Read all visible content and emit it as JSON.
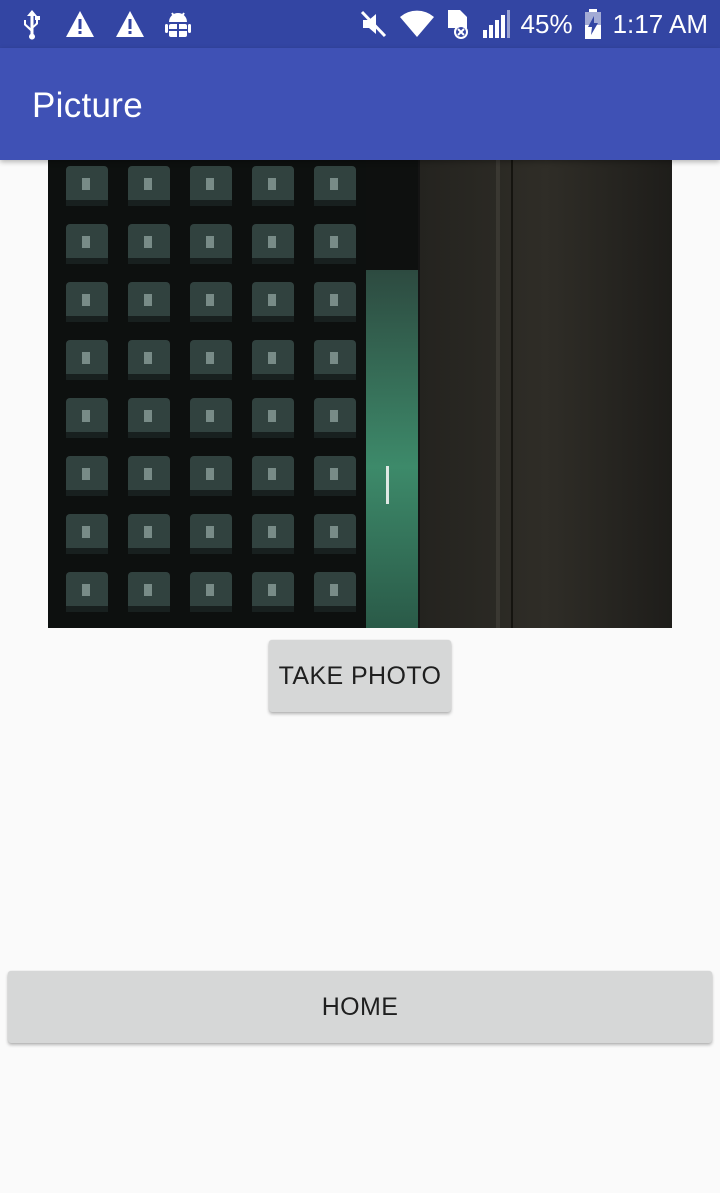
{
  "status_bar": {
    "icons_left": [
      "usb-icon",
      "warning-icon",
      "warning-icon",
      "android-debug-icon"
    ],
    "icons_right": [
      "mute-icon",
      "wifi-icon",
      "sim-error-icon",
      "signal-icon",
      "battery-charging-icon"
    ],
    "battery_percent": "45%",
    "time": "1:17 AM"
  },
  "app_bar": {
    "title": "Picture",
    "color": "#3f51b5",
    "status_color": "#3345a3"
  },
  "photo": {
    "subject": "keyboard-photo"
  },
  "buttons": {
    "take_photo": "TAKE PHOTO",
    "home": "HOME"
  }
}
